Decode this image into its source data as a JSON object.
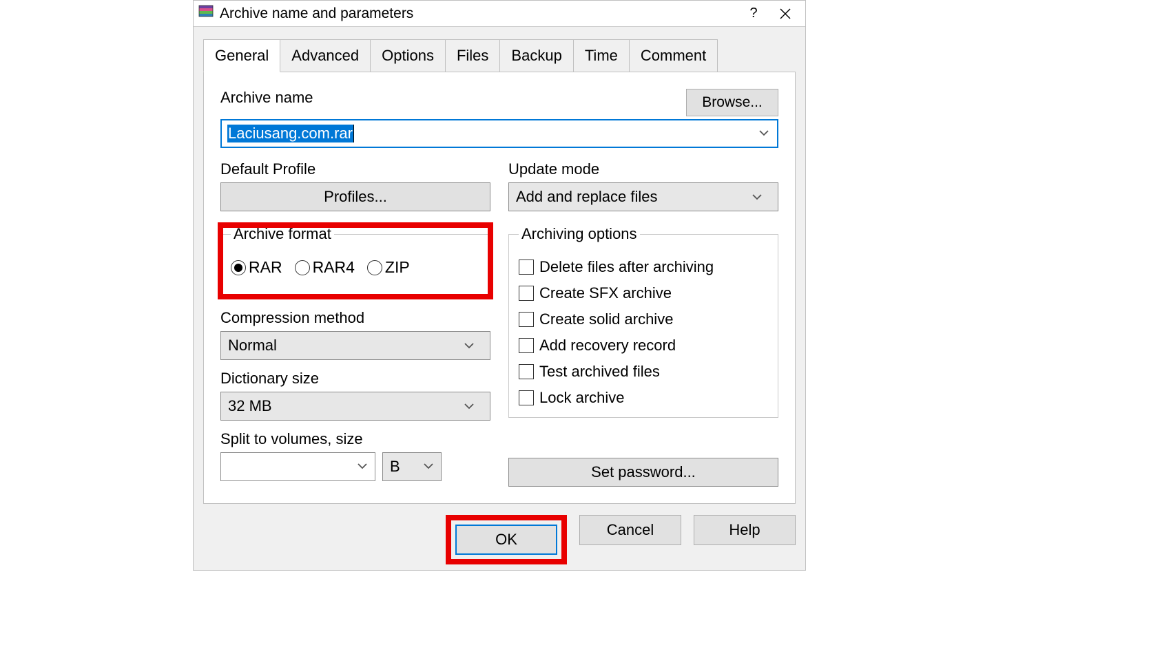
{
  "title": "Archive name and parameters",
  "tabs": [
    "General",
    "Advanced",
    "Options",
    "Files",
    "Backup",
    "Time",
    "Comment"
  ],
  "labels": {
    "archive_name": "Archive name",
    "browse": "Browse...",
    "default_profile": "Default Profile",
    "profiles": "Profiles...",
    "update_mode": "Update mode",
    "archive_format": "Archive format",
    "compression_method": "Compression method",
    "dictionary_size": "Dictionary size",
    "split_volumes": "Split to volumes, size",
    "archiving_options": "Archiving options",
    "set_password": "Set password..."
  },
  "archive_name_value": "Laciusang.com.rar",
  "update_mode_value": "Add and replace files",
  "formats": {
    "rar": "RAR",
    "rar4": "RAR4",
    "zip": "ZIP"
  },
  "format_selected": "RAR",
  "compression_value": "Normal",
  "dictionary_value": "32 MB",
  "volume_value": "",
  "volume_unit": "B",
  "options": {
    "delete_after": "Delete files after archiving",
    "create_sfx": "Create SFX archive",
    "create_solid": "Create solid archive",
    "add_recovery": "Add recovery record",
    "test_archived": "Test archived files",
    "lock_archive": "Lock archive"
  },
  "buttons": {
    "ok": "OK",
    "cancel": "Cancel",
    "help": "Help"
  }
}
